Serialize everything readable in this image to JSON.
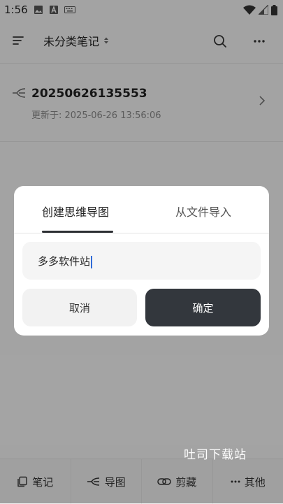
{
  "status_bar": {
    "time": "1:56"
  },
  "header": {
    "folder_label": "未分类笔记"
  },
  "note": {
    "title": "20250626135553",
    "updated": "更新于: 2025-06-26 13:56:06"
  },
  "dialog": {
    "tabs": [
      "创建思维导图",
      "从文件导入"
    ],
    "active_tab": 0,
    "input_value": "多多软件站",
    "cancel_label": "取消",
    "confirm_label": "确定"
  },
  "watermark": "吐司下载站",
  "bottom_nav": [
    {
      "label": "笔记",
      "icon": "note-icon"
    },
    {
      "label": "导图",
      "icon": "mindmap-icon"
    },
    {
      "label": "剪藏",
      "icon": "link-icon"
    },
    {
      "label": "其他",
      "icon": "more-horizontal-icon"
    }
  ],
  "colors": {
    "primary_button": "#33373d",
    "caret": "#2f6bd8"
  }
}
